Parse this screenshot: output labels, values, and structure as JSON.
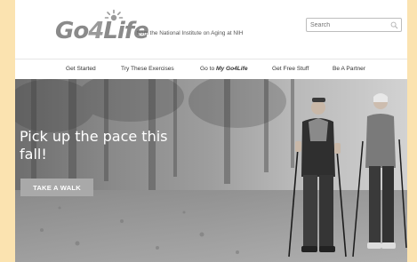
{
  "header": {
    "logo_main": "Go",
    "logo_four": "4",
    "logo_end": "Life",
    "tagline": "from the National Institute on Aging at NIH",
    "search_placeholder": "Search"
  },
  "nav": {
    "items": [
      {
        "label": "Get Started"
      },
      {
        "label": "Try These Exercises"
      },
      {
        "label_prefix": "Go to ",
        "label_em": "My Go4Life"
      },
      {
        "label": "Get Free Stuff"
      },
      {
        "label": "Be A Partner"
      }
    ]
  },
  "hero": {
    "headline": "Pick up the pace this fall!",
    "cta_label": "TAKE A WALK"
  },
  "colors": {
    "page_bg": "#fbe3b0",
    "cta_bg": "#a9a9a9"
  },
  "icons": [
    "sun-logo-icon",
    "search-icon"
  ]
}
